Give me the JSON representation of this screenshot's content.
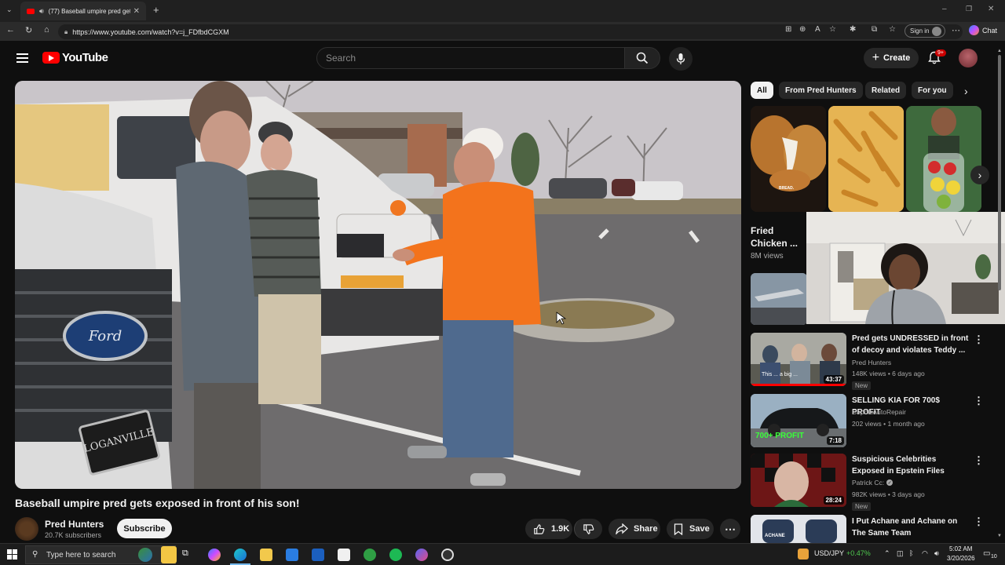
{
  "browser": {
    "tab_title": "(77) Baseball umpire pred gets",
    "url": "https://www.youtube.com/watch?v=j_FDfbdCGXM",
    "signin_label": "Sign in",
    "chat_label": "Chat"
  },
  "header": {
    "logo_text": "YouTube",
    "search_placeholder": "Search",
    "create_label": "Create",
    "notifications_badge": "9+"
  },
  "video": {
    "title": "Baseball umpire pred gets exposed in front of his son!",
    "channel": "Pred Hunters",
    "subscribers": "20.7K subscribers",
    "subscribe_label": "Subscribe",
    "likes": "1.9K",
    "share_label": "Share",
    "save_label": "Save"
  },
  "sidebar": {
    "chips": [
      "All",
      "From Pred Hunters",
      "Related",
      "For you"
    ],
    "shorts": [
      {
        "title": "Fried Chicken ...",
        "views": "8M views",
        "caption": "BREAD."
      }
    ],
    "recommendations": [
      {
        "title": "Pred gets UNDRESSED in front of decoy and violates Teddy ...",
        "channel": "Pred Hunters",
        "meta": "148K views • 6 days ago",
        "badge": "New",
        "duration": "43:37",
        "thumb_caption": "This ... a big ..."
      },
      {
        "title": "SELLING KIA FOR 700$ PROFIT",
        "channel": "CapoisAutoRepair",
        "meta": "202 views • 1 month ago",
        "badge": "",
        "duration": "7:18",
        "thumb_caption": "700+ PROFIT"
      },
      {
        "title": "Suspicious Celebrities Exposed in Epstein Files",
        "channel": "Patrick Cc:",
        "meta": "982K views • 3 days ago",
        "badge": "New",
        "duration": "28:24",
        "thumb_caption": ""
      },
      {
        "title": "I Put Achane and Achane on The Same Team",
        "channel": "",
        "meta": "",
        "badge": "",
        "duration": "",
        "thumb_caption": "ACHANE"
      }
    ]
  },
  "taskbar": {
    "search_placeholder": "Type here to search",
    "ticker": "USD/JPY",
    "ticker_change": "+0.47%",
    "time": "5:02 AM",
    "date": "3/20/2026",
    "notification_count": "10"
  },
  "colors": {
    "brand_red": "#ff0000",
    "background": "#0f0f0f",
    "ticker_green": "#4ec94e"
  }
}
